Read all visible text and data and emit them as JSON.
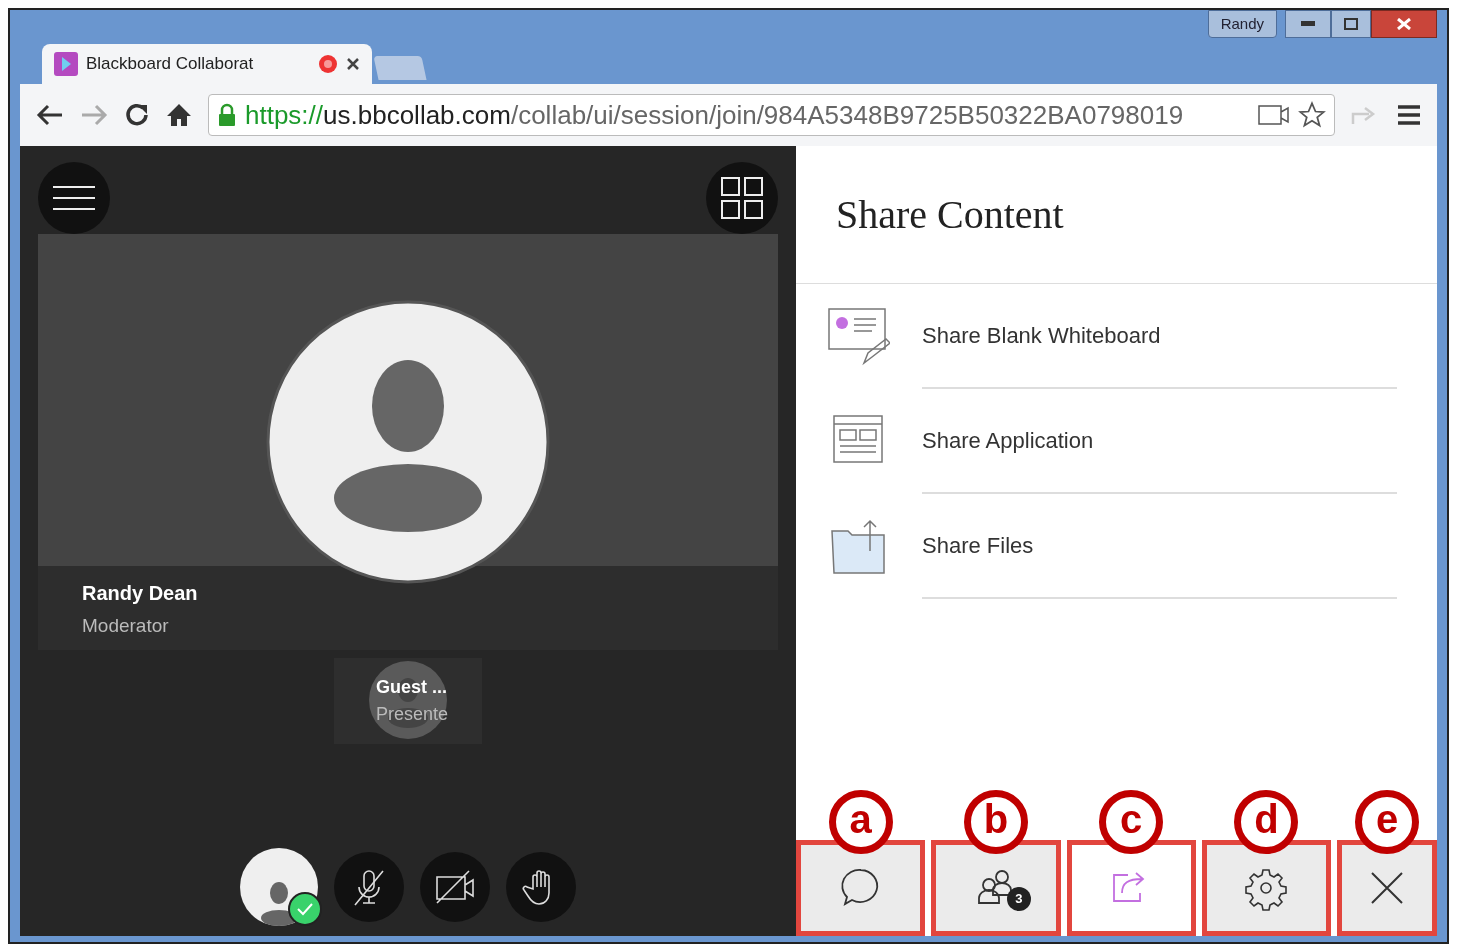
{
  "window": {
    "user": "Randy"
  },
  "tab": {
    "title": "Blackboard Collaborat"
  },
  "address_bar": {
    "scheme": "https://",
    "host": "us.bbcollab.com",
    "path": "/collab/ui/session/join/984A5348B9725B50322BA0798019"
  },
  "stage": {
    "presenter": {
      "name": "Randy Dean",
      "role": "Moderator"
    },
    "thumbnail": {
      "name": "Guest ...",
      "role": "Presente"
    }
  },
  "controls": [
    {
      "kind": "avatar"
    },
    {
      "kind": "mic"
    },
    {
      "kind": "camera"
    },
    {
      "kind": "hand"
    }
  ],
  "panel": {
    "title": "Share Content",
    "items": [
      {
        "kind": "whiteboard",
        "label": "Share Blank Whiteboard"
      },
      {
        "kind": "application",
        "label": "Share Application"
      },
      {
        "kind": "files",
        "label": "Share Files"
      }
    ]
  },
  "footer": [
    {
      "kind": "chat",
      "marker": "a",
      "selected": false
    },
    {
      "kind": "attendees",
      "marker": "b",
      "badge": "3",
      "selected": false
    },
    {
      "kind": "share",
      "marker": "c",
      "selected": true
    },
    {
      "kind": "settings",
      "marker": "d",
      "selected": false
    },
    {
      "kind": "close",
      "marker": "e",
      "selected": false
    }
  ]
}
